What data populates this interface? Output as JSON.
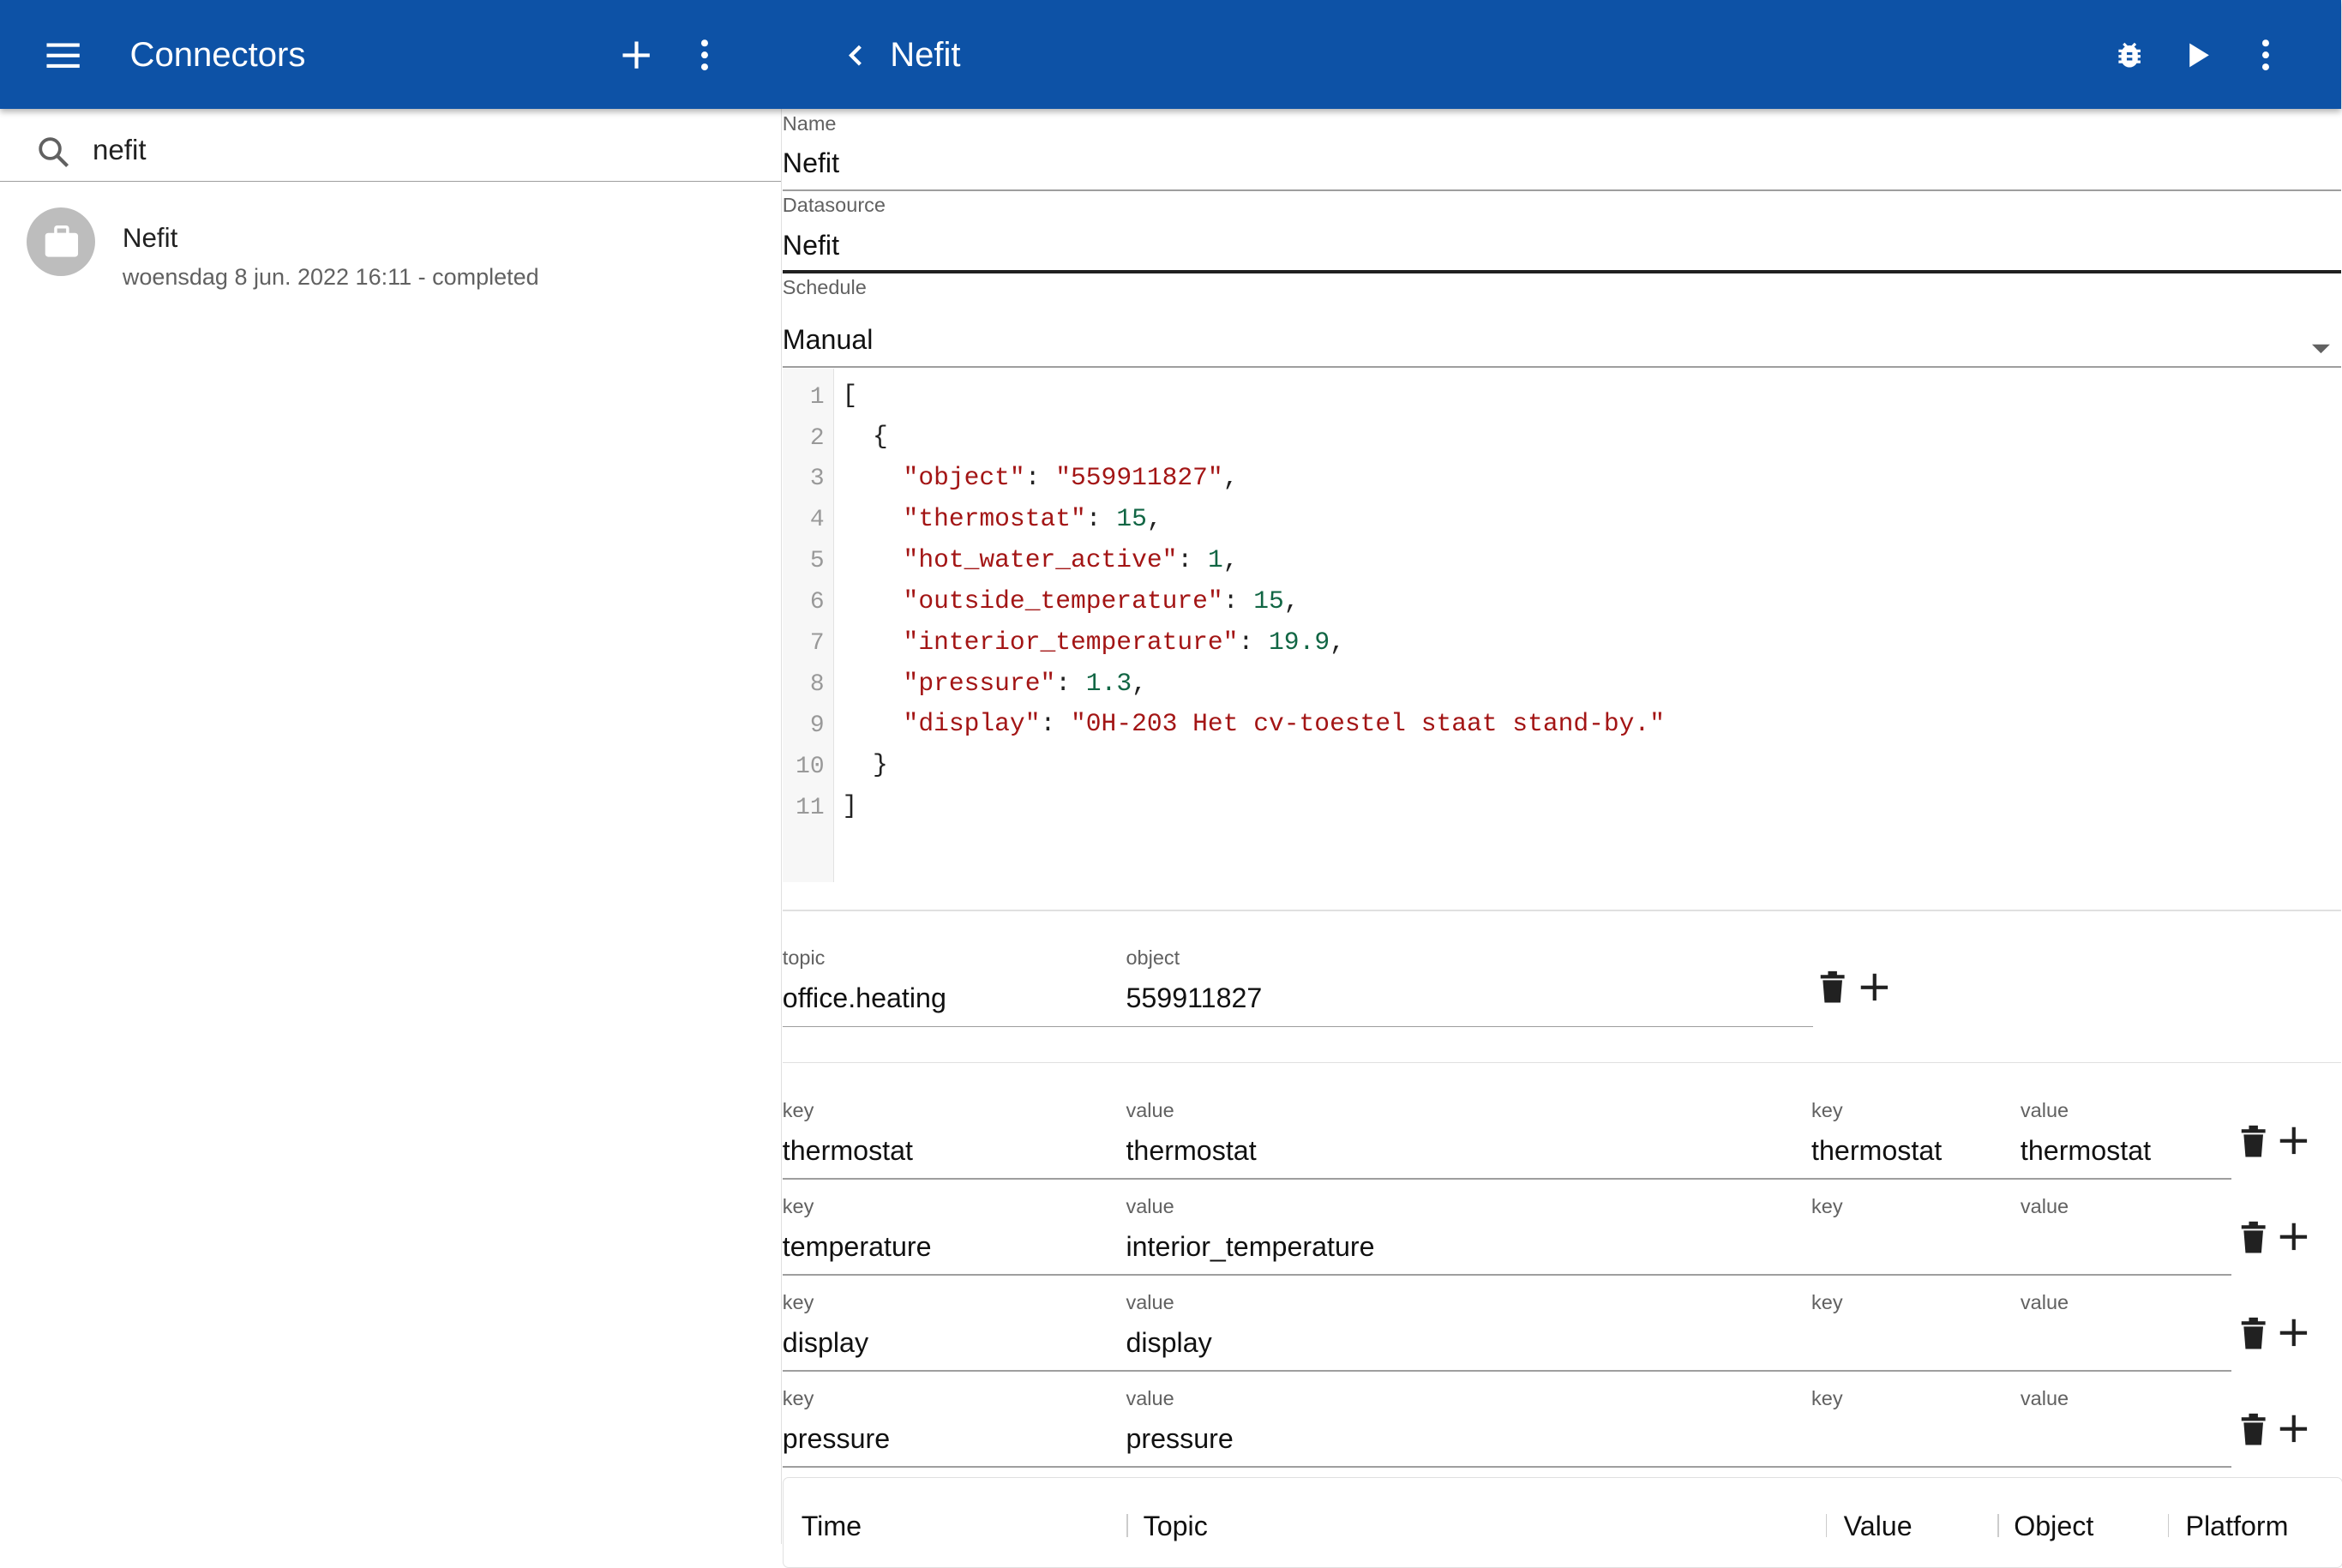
{
  "appbar": {
    "left_title": "Connectors",
    "right_title": "Nefit",
    "icons": [
      "menu-icon",
      "add-icon",
      "more-vert-icon",
      "chevron-left-icon",
      "bug-icon",
      "play-icon",
      "more-vert-icon"
    ]
  },
  "search": {
    "value": "nefit"
  },
  "list": [
    {
      "title": "Nefit",
      "subtitle": "woensdag 8 jun. 2022 16:11 - completed"
    }
  ],
  "form": {
    "name_label": "Name",
    "name_value": "Nefit",
    "datasource_label": "Datasource",
    "datasource_value": "Nefit",
    "schedule_label": "Schedule",
    "schedule_value": "Manual"
  },
  "editor": {
    "line_numbers": [
      "1",
      "2",
      "3",
      "4",
      "5",
      "6",
      "7",
      "8",
      "9",
      "10",
      "11"
    ],
    "lines": [
      "[",
      "  {",
      "    \"object\": \"559911827\",",
      "    \"thermostat\": 15,",
      "    \"hot_water_active\": 1,",
      "    \"outside_temperature\": 15,",
      "    \"interior_temperature\": 19.9,",
      "    \"pressure\": 1.3,",
      "    \"display\": \"0H-203 Het cv-toestel staat stand-by.\"",
      "  }",
      "]"
    ]
  },
  "topic_row": {
    "topic_label": "topic",
    "topic_value": "office.heating",
    "object_label": "object",
    "object_value": "559911827"
  },
  "mapping": {
    "key_label": "key",
    "value_label": "value",
    "rows": [
      {
        "key": "thermostat",
        "value": "thermostat",
        "key2": "thermostat",
        "value2": "thermostat"
      },
      {
        "key": "temperature",
        "value": "interior_temperature",
        "key2": "",
        "value2": ""
      },
      {
        "key": "display",
        "value": "display",
        "key2": "",
        "value2": ""
      },
      {
        "key": "pressure",
        "value": "pressure",
        "key2": "",
        "value2": ""
      }
    ]
  },
  "table": {
    "headers": [
      "Time",
      "Topic",
      "Value",
      "Object",
      "Platform"
    ]
  }
}
